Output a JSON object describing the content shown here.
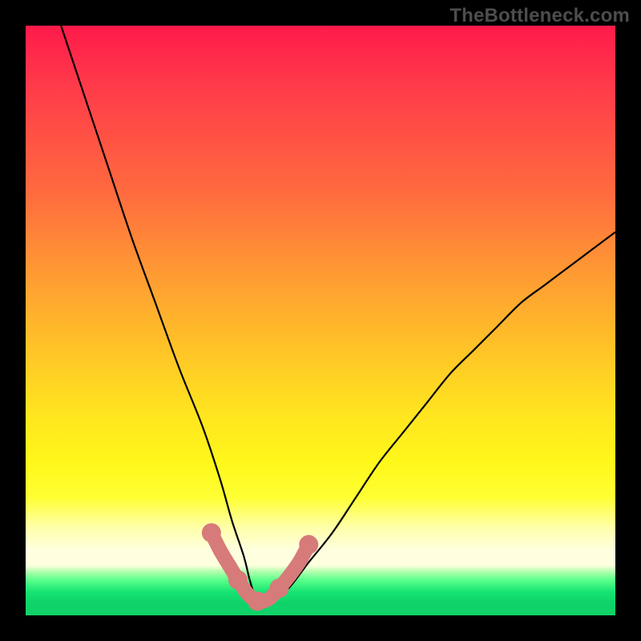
{
  "watermark": "TheBottleneck.com",
  "chart_data": {
    "type": "line",
    "title": "",
    "xlabel": "",
    "ylabel": "",
    "xlim": [
      0,
      100
    ],
    "ylim": [
      0,
      100
    ],
    "grid": false,
    "legend": false,
    "series": [
      {
        "name": "black-curve",
        "color": "#000000",
        "x": [
          6,
          10,
          14,
          18,
          22,
          26,
          30,
          33,
          35,
          37,
          38,
          39,
          40,
          44,
          48,
          52,
          56,
          60,
          64,
          68,
          72,
          76,
          80,
          84,
          88,
          92,
          96,
          100
        ],
        "values": [
          100,
          88,
          76,
          64,
          53,
          42,
          32,
          23,
          16,
          10,
          6,
          3,
          2,
          4,
          9,
          14,
          20,
          26,
          31,
          36,
          41,
          45,
          49,
          53,
          56,
          59,
          62,
          65
        ]
      },
      {
        "name": "pink-markers",
        "color": "#d77a7a",
        "x": [
          31.5,
          33.0,
          34.5,
          36.0,
          37.2,
          38.3,
          39.3,
          40.3,
          41.5,
          43.0,
          44.8,
          46.5,
          48.0
        ],
        "values": [
          14.0,
          11.0,
          8.5,
          6.0,
          4.2,
          3.0,
          2.4,
          2.4,
          3.0,
          4.6,
          6.8,
          9.2,
          12.0
        ]
      }
    ]
  }
}
